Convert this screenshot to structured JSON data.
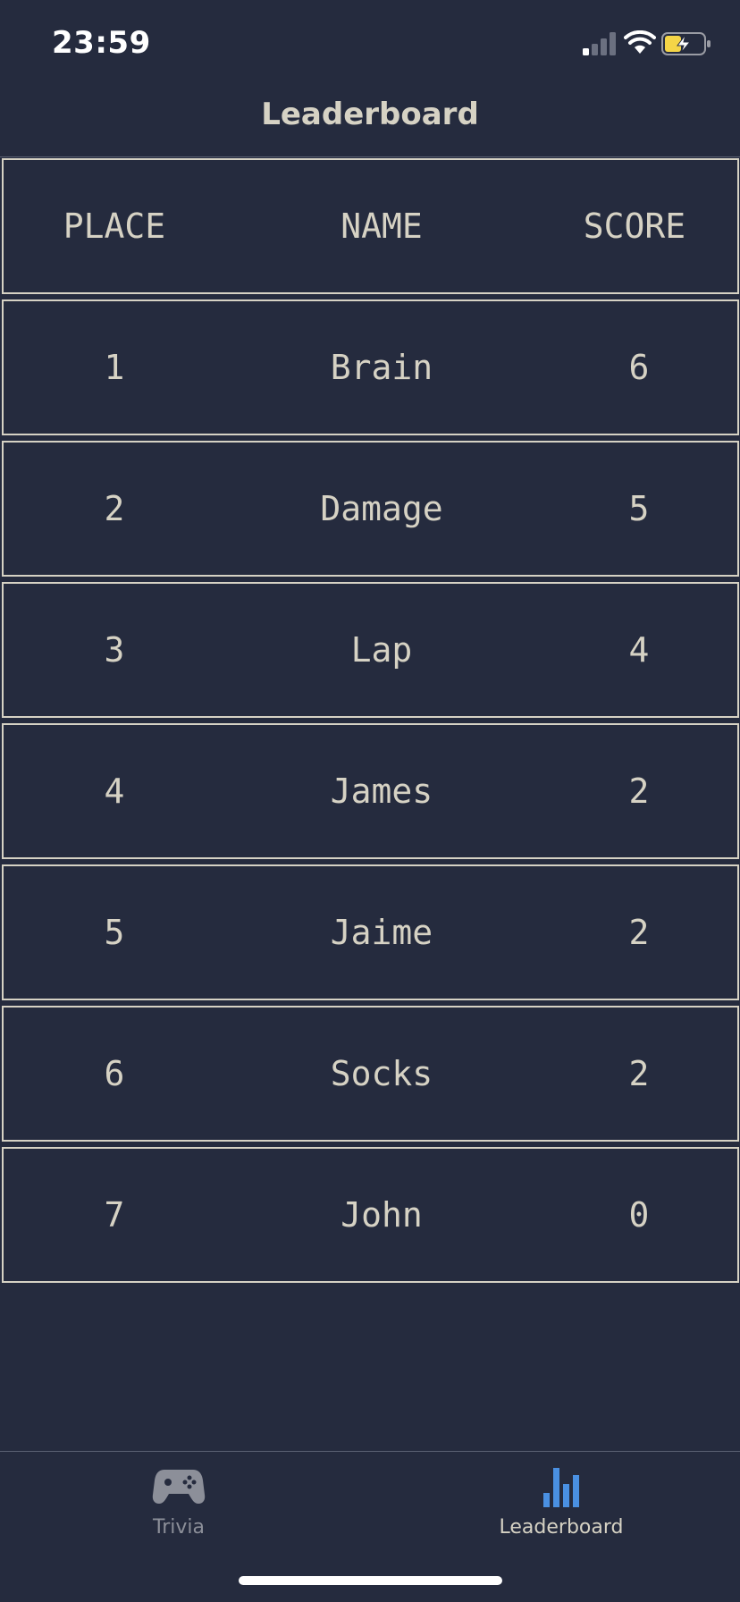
{
  "status_bar": {
    "time": "23:59"
  },
  "nav": {
    "title": "Leaderboard"
  },
  "table": {
    "headers": {
      "place": "PLACE",
      "name": "NAME",
      "score": "SCORE"
    },
    "rows": [
      {
        "place": "1",
        "name": "Brain",
        "score": "6"
      },
      {
        "place": "2",
        "name": "Damage",
        "score": "5"
      },
      {
        "place": "3",
        "name": "Lap",
        "score": "4"
      },
      {
        "place": "4",
        "name": "James",
        "score": "2"
      },
      {
        "place": "5",
        "name": "Jaime",
        "score": "2"
      },
      {
        "place": "6",
        "name": "Socks",
        "score": "2"
      },
      {
        "place": "7",
        "name": "John",
        "score": "0"
      }
    ]
  },
  "tab_bar": {
    "tabs": [
      {
        "label": "Trivia",
        "icon": "gamepad-icon",
        "selected": false
      },
      {
        "label": "Leaderboard",
        "icon": "bar-chart-icon",
        "selected": true
      }
    ]
  },
  "colors": {
    "background": "#252b3e",
    "text": "#d6d2c4",
    "accent": "#4a90e2",
    "inactive": "#8c8f99",
    "battery": "#f5d547"
  }
}
